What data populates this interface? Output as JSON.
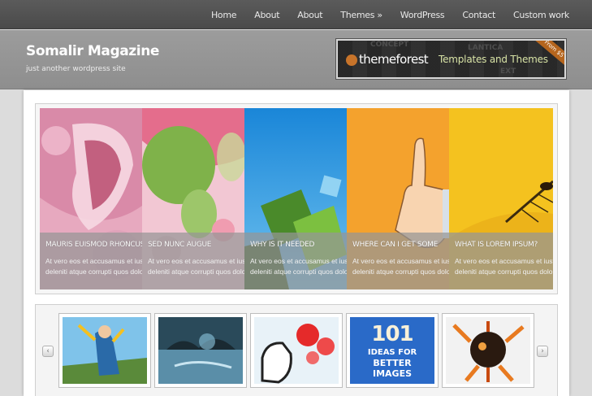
{
  "nav": {
    "items": [
      "Home",
      "About",
      "About",
      "Themes »",
      "WordPress",
      "Contact",
      "Custom work"
    ]
  },
  "header": {
    "title": "Somalir Magazine",
    "tagline": "just another wordpress site"
  },
  "ad": {
    "brand": "themeforest",
    "subtitle": "Templates and Themes",
    "ribbon": "From $5",
    "background_words": [
      "CONCEPT",
      "LANTICA",
      "EXT"
    ]
  },
  "slider": {
    "slides": [
      {
        "title": "MAURIS EUISMOD RHONCUS TORTOR",
        "line1": "At vero eos et accusamus et iusto",
        "line2": "deleniti atque corrupti quos dolore",
        "colors": [
          "#e8a0b8",
          "#c06080"
        ]
      },
      {
        "title": "SED NUNC AUGUE",
        "line1": "At vero eos et accusamus et iusto",
        "line2": "deleniti atque corrupti quos dolore",
        "colors": [
          "#8fc060",
          "#f0b0c0"
        ]
      },
      {
        "title": "WHY IS IT NEEDED",
        "line1": "At vero eos et accusamus et iusto",
        "line2": "deleniti atque corrupti quos dolore",
        "colors": [
          "#2a8fd8",
          "#5a9a30"
        ]
      },
      {
        "title": "WHERE CAN I GET SOME",
        "line1": "At vero eos et accusamus et iusto",
        "line2": "deleniti atque corrupti quos dolore",
        "colors": [
          "#f49020",
          "#f0b030"
        ]
      },
      {
        "title": "WHAT IS LOREM IPSUM?",
        "line1": "At vero eos et accusamus et iusto",
        "line2": "deleniti atque corrupti quos dolore",
        "colors": [
          "#f4c020",
          "#e8a818"
        ]
      }
    ]
  },
  "thumbs": {
    "prev": "‹",
    "next": "›",
    "items": [
      {
        "caption": ""
      },
      {
        "caption": ""
      },
      {
        "caption": ""
      },
      {
        "caption": "101 IDEAS FOR BETTER IMAGES"
      },
      {
        "caption": ""
      }
    ],
    "thumb4": {
      "number": "101",
      "line1": "IDEAS FOR",
      "line2": "BETTER",
      "line3": "IMAGES"
    }
  }
}
